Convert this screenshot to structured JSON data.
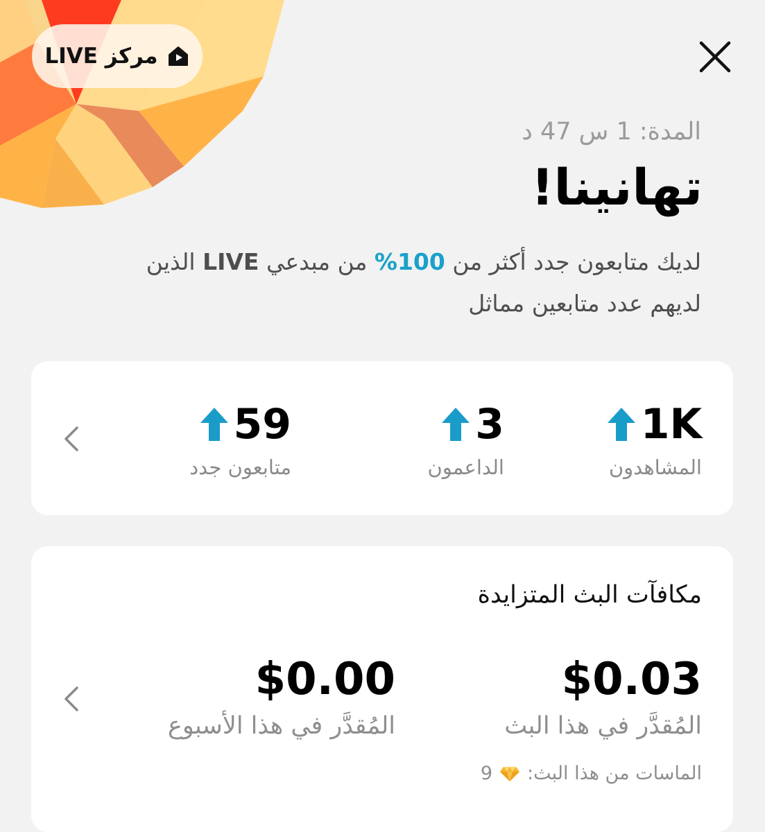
{
  "header": {
    "live_center_label": "مركز LIVE",
    "close_icon": "close-icon",
    "live_icon": "live-home-icon"
  },
  "summary": {
    "duration_text": "المدة: 1 س 47 د",
    "headline": "تهانينا!",
    "subtitle_part1": "لديك متابعون جدد أكثر من ",
    "subtitle_percent": "100%",
    "subtitle_part2": " من مبدعي ",
    "subtitle_live": "LIVE",
    "subtitle_part3": " الذين لديهم عدد متابعين مماثل"
  },
  "stats": {
    "items": [
      {
        "value": "1K",
        "label": "المشاهدون",
        "trend": "up"
      },
      {
        "value": "3",
        "label": "الداعمون",
        "trend": "up"
      },
      {
        "value": "59",
        "label": "متابعون جدد",
        "trend": "up"
      }
    ]
  },
  "rewards": {
    "title": "مكافآت البث المتزايدة",
    "this_stream_amount": "$0.03",
    "this_stream_label": "المُقدَّر في هذا البث",
    "this_week_amount": "$0.00",
    "this_week_label": "المُقدَّر في هذا الأسبوع",
    "diamonds_label": "الماسات من هذا البث:",
    "diamonds_count": "9"
  },
  "colors": {
    "accent": "#1aa1cb",
    "background": "#f2f2f2",
    "card": "#ffffff",
    "muted_text": "#8a8a8a"
  }
}
